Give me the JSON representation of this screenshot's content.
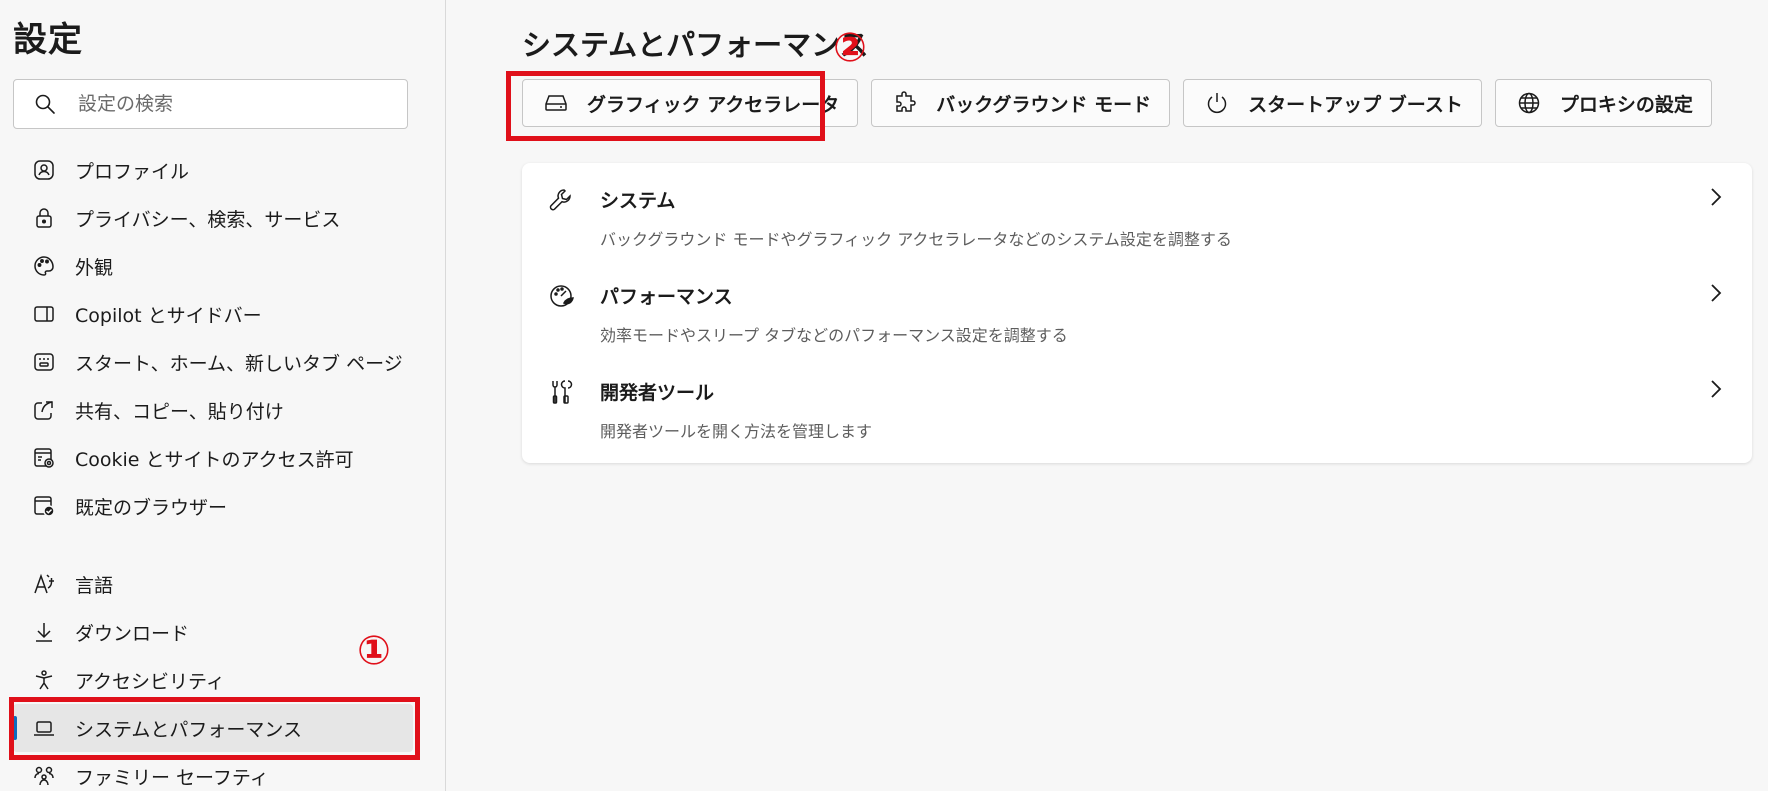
{
  "sidebar": {
    "title": "設定",
    "search": {
      "placeholder": "設定の検索",
      "icon": "search-icon"
    },
    "items": [
      {
        "label": "プロファイル",
        "icon": "profile-icon"
      },
      {
        "label": "プライバシー、検索、サービス",
        "icon": "lock-icon"
      },
      {
        "label": "外観",
        "icon": "palette-icon"
      },
      {
        "label": "Copilot とサイドバー",
        "icon": "sidebar-icon"
      },
      {
        "label": "スタート、ホーム、新しいタブ ページ",
        "icon": "home-page-icon"
      },
      {
        "label": "共有、コピー、貼り付け",
        "icon": "share-icon"
      },
      {
        "label": "Cookie とサイトのアクセス許可",
        "icon": "site-permissions-icon"
      },
      {
        "label": "既定のブラウザー",
        "icon": "default-browser-icon"
      },
      {
        "label": "言語",
        "icon": "language-icon"
      },
      {
        "label": "ダウンロード",
        "icon": "download-icon"
      },
      {
        "label": "アクセシビリティ",
        "icon": "accessibility-icon"
      },
      {
        "label": "システムとパフォーマンス",
        "icon": "laptop-icon",
        "active": true
      },
      {
        "label": "ファミリー セーフティ",
        "icon": "family-icon"
      }
    ]
  },
  "main": {
    "title": "システムとパフォーマンス",
    "quick_buttons": [
      {
        "label": "グラフィック アクセラレータ",
        "icon": "gpu-icon"
      },
      {
        "label": "バックグラウンド モード",
        "icon": "puzzle-icon"
      },
      {
        "label": "スタートアップ ブースト",
        "icon": "power-icon"
      },
      {
        "label": "プロキシの設定",
        "icon": "globe-icon"
      }
    ],
    "rows": [
      {
        "title": "システム",
        "desc": "バックグラウンド モードやグラフィック アクセラレータなどのシステム設定を調整する",
        "icon": "wrench-icon"
      },
      {
        "title": "パフォーマンス",
        "desc": "効率モードやスリープ タブなどのパフォーマンス設定を調整する",
        "icon": "performance-icon"
      },
      {
        "title": "開発者ツール",
        "desc": "開発者ツールを開く方法を管理します",
        "icon": "dev-tools-icon"
      }
    ]
  },
  "annotations": {
    "marker1": "①",
    "marker2": "②",
    "color": "#e0101a"
  },
  "colors": {
    "accent": "#0f6cbd",
    "active_bg": "#e6e6e6",
    "annotation": "#e0101a"
  }
}
